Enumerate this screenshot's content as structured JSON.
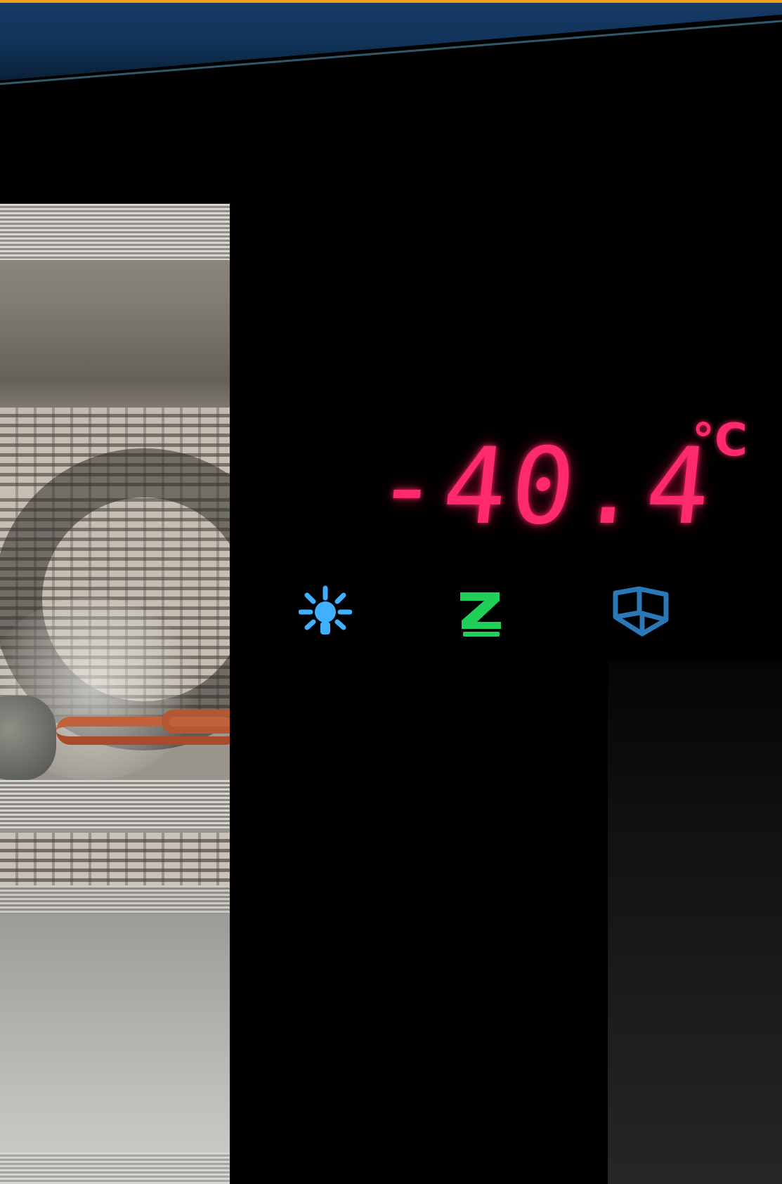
{
  "display": {
    "temperature": "-40.4",
    "unit": "°C",
    "color": "#ff2a6b"
  },
  "indicators": [
    {
      "name": "light-icon",
      "color": "#3fb0ff"
    },
    {
      "name": "eco-icon",
      "color": "#1fcf58"
    },
    {
      "name": "ice-cube-icon",
      "color": "#2a78b8"
    }
  ]
}
